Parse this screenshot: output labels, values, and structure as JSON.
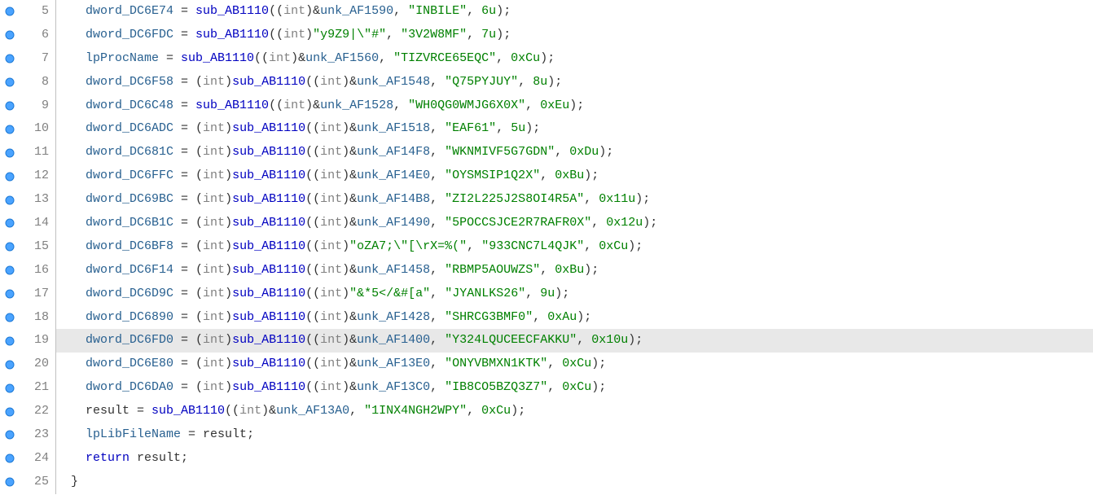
{
  "lines": [
    {
      "n": 5,
      "bp": true,
      "hl": false,
      "seg": [
        [
          "indent",
          ""
        ],
        [
          "global",
          "dword_DC6E74"
        ],
        [
          "op",
          " = "
        ],
        [
          "func",
          "sub_AB1110"
        ],
        [
          "op",
          "(("
        ],
        [
          "cast",
          "int"
        ],
        [
          "op",
          ")&"
        ],
        [
          "unk",
          "unk_AF1590"
        ],
        [
          "op",
          ", "
        ],
        [
          "str",
          "\"INBILE\""
        ],
        [
          "op",
          ", "
        ],
        [
          "num",
          "6u"
        ],
        [
          "op",
          ");"
        ]
      ]
    },
    {
      "n": 6,
      "bp": true,
      "hl": false,
      "seg": [
        [
          "indent",
          ""
        ],
        [
          "global",
          "dword_DC6FDC"
        ],
        [
          "op",
          " = "
        ],
        [
          "func",
          "sub_AB1110"
        ],
        [
          "op",
          "(("
        ],
        [
          "cast",
          "int"
        ],
        [
          "op",
          ")"
        ],
        [
          "str",
          "\"y9Z9|\\\"#\""
        ],
        [
          "op",
          ", "
        ],
        [
          "str",
          "\"3V2W8MF\""
        ],
        [
          "op",
          ", "
        ],
        [
          "num",
          "7u"
        ],
        [
          "op",
          ");"
        ]
      ]
    },
    {
      "n": 7,
      "bp": true,
      "hl": false,
      "seg": [
        [
          "indent",
          ""
        ],
        [
          "global",
          "lpProcName"
        ],
        [
          "op",
          " = "
        ],
        [
          "func",
          "sub_AB1110"
        ],
        [
          "op",
          "(("
        ],
        [
          "cast",
          "int"
        ],
        [
          "op",
          ")&"
        ],
        [
          "unk",
          "unk_AF1560"
        ],
        [
          "op",
          ", "
        ],
        [
          "str",
          "\"TIZVRCE65EQC\""
        ],
        [
          "op",
          ", "
        ],
        [
          "num",
          "0xCu"
        ],
        [
          "op",
          ");"
        ]
      ]
    },
    {
      "n": 8,
      "bp": true,
      "hl": false,
      "seg": [
        [
          "indent",
          ""
        ],
        [
          "global",
          "dword_DC6F58"
        ],
        [
          "op",
          " = ("
        ],
        [
          "cast",
          "int"
        ],
        [
          "op",
          ")"
        ],
        [
          "func",
          "sub_AB1110"
        ],
        [
          "op",
          "(("
        ],
        [
          "cast",
          "int"
        ],
        [
          "op",
          ")&"
        ],
        [
          "unk",
          "unk_AF1548"
        ],
        [
          "op",
          ", "
        ],
        [
          "str",
          "\"Q75PYJUY\""
        ],
        [
          "op",
          ", "
        ],
        [
          "num",
          "8u"
        ],
        [
          "op",
          ");"
        ]
      ]
    },
    {
      "n": 9,
      "bp": true,
      "hl": false,
      "seg": [
        [
          "indent",
          ""
        ],
        [
          "global",
          "dword_DC6C48"
        ],
        [
          "op",
          " = "
        ],
        [
          "func",
          "sub_AB1110"
        ],
        [
          "op",
          "(("
        ],
        [
          "cast",
          "int"
        ],
        [
          "op",
          ")&"
        ],
        [
          "unk",
          "unk_AF1528"
        ],
        [
          "op",
          ", "
        ],
        [
          "str",
          "\"WH0QG0WMJG6X0X\""
        ],
        [
          "op",
          ", "
        ],
        [
          "num",
          "0xEu"
        ],
        [
          "op",
          ");"
        ]
      ]
    },
    {
      "n": 10,
      "bp": true,
      "hl": false,
      "seg": [
        [
          "indent",
          ""
        ],
        [
          "global",
          "dword_DC6ADC"
        ],
        [
          "op",
          " = ("
        ],
        [
          "cast",
          "int"
        ],
        [
          "op",
          ")"
        ],
        [
          "func",
          "sub_AB1110"
        ],
        [
          "op",
          "(("
        ],
        [
          "cast",
          "int"
        ],
        [
          "op",
          ")&"
        ],
        [
          "unk",
          "unk_AF1518"
        ],
        [
          "op",
          ", "
        ],
        [
          "str",
          "\"EAF61\""
        ],
        [
          "op",
          ", "
        ],
        [
          "num",
          "5u"
        ],
        [
          "op",
          ");"
        ]
      ]
    },
    {
      "n": 11,
      "bp": true,
      "hl": false,
      "seg": [
        [
          "indent",
          ""
        ],
        [
          "global",
          "dword_DC681C"
        ],
        [
          "op",
          " = ("
        ],
        [
          "cast",
          "int"
        ],
        [
          "op",
          ")"
        ],
        [
          "func",
          "sub_AB1110"
        ],
        [
          "op",
          "(("
        ],
        [
          "cast",
          "int"
        ],
        [
          "op",
          ")&"
        ],
        [
          "unk",
          "unk_AF14F8"
        ],
        [
          "op",
          ", "
        ],
        [
          "str",
          "\"WKNMIVF5G7GDN\""
        ],
        [
          "op",
          ", "
        ],
        [
          "num",
          "0xDu"
        ],
        [
          "op",
          ");"
        ]
      ]
    },
    {
      "n": 12,
      "bp": true,
      "hl": false,
      "seg": [
        [
          "indent",
          ""
        ],
        [
          "global",
          "dword_DC6FFC"
        ],
        [
          "op",
          " = ("
        ],
        [
          "cast",
          "int"
        ],
        [
          "op",
          ")"
        ],
        [
          "func",
          "sub_AB1110"
        ],
        [
          "op",
          "(("
        ],
        [
          "cast",
          "int"
        ],
        [
          "op",
          ")&"
        ],
        [
          "unk",
          "unk_AF14E0"
        ],
        [
          "op",
          ", "
        ],
        [
          "str",
          "\"OYSMSIP1Q2X\""
        ],
        [
          "op",
          ", "
        ],
        [
          "num",
          "0xBu"
        ],
        [
          "op",
          ");"
        ]
      ]
    },
    {
      "n": 13,
      "bp": true,
      "hl": false,
      "seg": [
        [
          "indent",
          ""
        ],
        [
          "global",
          "dword_DC69BC"
        ],
        [
          "op",
          " = ("
        ],
        [
          "cast",
          "int"
        ],
        [
          "op",
          ")"
        ],
        [
          "func",
          "sub_AB1110"
        ],
        [
          "op",
          "(("
        ],
        [
          "cast",
          "int"
        ],
        [
          "op",
          ")&"
        ],
        [
          "unk",
          "unk_AF14B8"
        ],
        [
          "op",
          ", "
        ],
        [
          "str",
          "\"ZI2L225J2S8OI4R5A\""
        ],
        [
          "op",
          ", "
        ],
        [
          "num",
          "0x11u"
        ],
        [
          "op",
          ");"
        ]
      ]
    },
    {
      "n": 14,
      "bp": true,
      "hl": false,
      "seg": [
        [
          "indent",
          ""
        ],
        [
          "global",
          "dword_DC6B1C"
        ],
        [
          "op",
          " = ("
        ],
        [
          "cast",
          "int"
        ],
        [
          "op",
          ")"
        ],
        [
          "func",
          "sub_AB1110"
        ],
        [
          "op",
          "(("
        ],
        [
          "cast",
          "int"
        ],
        [
          "op",
          ")&"
        ],
        [
          "unk",
          "unk_AF1490"
        ],
        [
          "op",
          ", "
        ],
        [
          "str",
          "\"5POCCSJCE2R7RAFR0X\""
        ],
        [
          "op",
          ", "
        ],
        [
          "num",
          "0x12u"
        ],
        [
          "op",
          ");"
        ]
      ]
    },
    {
      "n": 15,
      "bp": true,
      "hl": false,
      "seg": [
        [
          "indent",
          ""
        ],
        [
          "global",
          "dword_DC6BF8"
        ],
        [
          "op",
          " = ("
        ],
        [
          "cast",
          "int"
        ],
        [
          "op",
          ")"
        ],
        [
          "func",
          "sub_AB1110"
        ],
        [
          "op",
          "(("
        ],
        [
          "cast",
          "int"
        ],
        [
          "op",
          ")"
        ],
        [
          "str",
          "\"oZA7;\\\"[\\rX=%(\""
        ],
        [
          "op",
          ", "
        ],
        [
          "str",
          "\"933CNC7L4QJK\""
        ],
        [
          "op",
          ", "
        ],
        [
          "num",
          "0xCu"
        ],
        [
          "op",
          ");"
        ]
      ]
    },
    {
      "n": 16,
      "bp": true,
      "hl": false,
      "seg": [
        [
          "indent",
          ""
        ],
        [
          "global",
          "dword_DC6F14"
        ],
        [
          "op",
          " = ("
        ],
        [
          "cast",
          "int"
        ],
        [
          "op",
          ")"
        ],
        [
          "func",
          "sub_AB1110"
        ],
        [
          "op",
          "(("
        ],
        [
          "cast",
          "int"
        ],
        [
          "op",
          ")&"
        ],
        [
          "unk",
          "unk_AF1458"
        ],
        [
          "op",
          ", "
        ],
        [
          "str",
          "\"RBMP5AOUWZS\""
        ],
        [
          "op",
          ", "
        ],
        [
          "num",
          "0xBu"
        ],
        [
          "op",
          ");"
        ]
      ]
    },
    {
      "n": 17,
      "bp": true,
      "hl": false,
      "seg": [
        [
          "indent",
          ""
        ],
        [
          "global",
          "dword_DC6D9C"
        ],
        [
          "op",
          " = ("
        ],
        [
          "cast",
          "int"
        ],
        [
          "op",
          ")"
        ],
        [
          "func",
          "sub_AB1110"
        ],
        [
          "op",
          "(("
        ],
        [
          "cast",
          "int"
        ],
        [
          "op",
          ")"
        ],
        [
          "str",
          "\"&*5</&#[a\""
        ],
        [
          "op",
          ", "
        ],
        [
          "str",
          "\"JYANLKS26\""
        ],
        [
          "op",
          ", "
        ],
        [
          "num",
          "9u"
        ],
        [
          "op",
          ");"
        ]
      ]
    },
    {
      "n": 18,
      "bp": true,
      "hl": false,
      "seg": [
        [
          "indent",
          ""
        ],
        [
          "global",
          "dword_DC6890"
        ],
        [
          "op",
          " = ("
        ],
        [
          "cast",
          "int"
        ],
        [
          "op",
          ")"
        ],
        [
          "func",
          "sub_AB1110"
        ],
        [
          "op",
          "(("
        ],
        [
          "cast",
          "int"
        ],
        [
          "op",
          ")&"
        ],
        [
          "unk",
          "unk_AF1428"
        ],
        [
          "op",
          ", "
        ],
        [
          "str",
          "\"SHRCG3BMF0\""
        ],
        [
          "op",
          ", "
        ],
        [
          "num",
          "0xAu"
        ],
        [
          "op",
          ");"
        ]
      ]
    },
    {
      "n": 19,
      "bp": true,
      "hl": true,
      "seg": [
        [
          "indent",
          ""
        ],
        [
          "global",
          "dword_DC6FD0"
        ],
        [
          "op",
          " = ("
        ],
        [
          "cast",
          "int"
        ],
        [
          "op",
          ")"
        ],
        [
          "func",
          "sub_AB1110"
        ],
        [
          "op",
          "(("
        ],
        [
          "cast",
          "int"
        ],
        [
          "op",
          ")&"
        ],
        [
          "unk",
          "unk_AF1400"
        ],
        [
          "op",
          ", "
        ],
        [
          "str",
          "\"Y324LQUCEECFAKKU\""
        ],
        [
          "op",
          ", "
        ],
        [
          "num",
          "0x10u"
        ],
        [
          "op",
          ");"
        ]
      ]
    },
    {
      "n": 20,
      "bp": true,
      "hl": false,
      "seg": [
        [
          "indent",
          ""
        ],
        [
          "global",
          "dword_DC6E80"
        ],
        [
          "op",
          " = ("
        ],
        [
          "cast",
          "int"
        ],
        [
          "op",
          ")"
        ],
        [
          "func",
          "sub_AB1110"
        ],
        [
          "op",
          "(("
        ],
        [
          "cast",
          "int"
        ],
        [
          "op",
          ")&"
        ],
        [
          "unk",
          "unk_AF13E0"
        ],
        [
          "op",
          ", "
        ],
        [
          "str",
          "\"ONYVBMXN1KTK\""
        ],
        [
          "op",
          ", "
        ],
        [
          "num",
          "0xCu"
        ],
        [
          "op",
          ");"
        ]
      ]
    },
    {
      "n": 21,
      "bp": true,
      "hl": false,
      "seg": [
        [
          "indent",
          ""
        ],
        [
          "global",
          "dword_DC6DA0"
        ],
        [
          "op",
          " = ("
        ],
        [
          "cast",
          "int"
        ],
        [
          "op",
          ")"
        ],
        [
          "func",
          "sub_AB1110"
        ],
        [
          "op",
          "(("
        ],
        [
          "cast",
          "int"
        ],
        [
          "op",
          ")&"
        ],
        [
          "unk",
          "unk_AF13C0"
        ],
        [
          "op",
          ", "
        ],
        [
          "str",
          "\"IB8CO5BZQ3Z7\""
        ],
        [
          "op",
          ", "
        ],
        [
          "num",
          "0xCu"
        ],
        [
          "op",
          ");"
        ]
      ]
    },
    {
      "n": 22,
      "bp": true,
      "hl": false,
      "seg": [
        [
          "indent",
          ""
        ],
        [
          "ident",
          "result"
        ],
        [
          "op",
          " = "
        ],
        [
          "func",
          "sub_AB1110"
        ],
        [
          "op",
          "(("
        ],
        [
          "cast",
          "int"
        ],
        [
          "op",
          ")&"
        ],
        [
          "unk",
          "unk_AF13A0"
        ],
        [
          "op",
          ", "
        ],
        [
          "str",
          "\"1INX4NGH2WPY\""
        ],
        [
          "op",
          ", "
        ],
        [
          "num",
          "0xCu"
        ],
        [
          "op",
          ");"
        ]
      ]
    },
    {
      "n": 23,
      "bp": true,
      "hl": false,
      "seg": [
        [
          "indent",
          ""
        ],
        [
          "global",
          "lpLibFileName"
        ],
        [
          "op",
          " = "
        ],
        [
          "ident",
          "result"
        ],
        [
          "op",
          ";"
        ]
      ]
    },
    {
      "n": 24,
      "bp": true,
      "hl": false,
      "seg": [
        [
          "indent",
          ""
        ],
        [
          "keyword",
          "return"
        ],
        [
          "op",
          " "
        ],
        [
          "ident",
          "result"
        ],
        [
          "op",
          ";"
        ]
      ]
    },
    {
      "n": 25,
      "bp": true,
      "hl": false,
      "seg": [
        [
          "brace",
          "}"
        ]
      ]
    }
  ]
}
